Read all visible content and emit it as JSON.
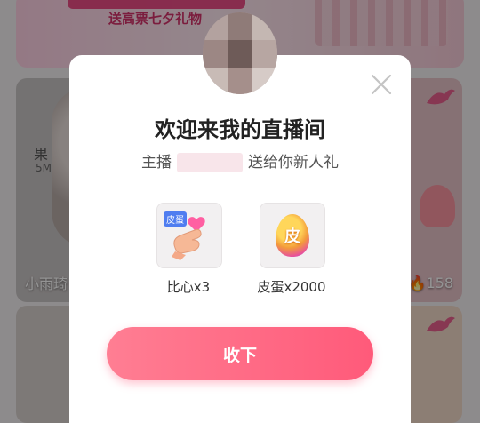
{
  "background": {
    "banner_text": "送高票七夕礼物",
    "card_left_name": "小雨琦",
    "card_left_side_text": "果",
    "card_left_side_small": "5M",
    "card_right_count": "158"
  },
  "modal": {
    "title": "欢迎来我的直播间",
    "subtitle_prefix": "主播",
    "subtitle_suffix": "送给你新人礼",
    "gifts": [
      {
        "icon": "finger-heart-icon",
        "tag": "皮蛋",
        "label": "比心x3"
      },
      {
        "icon": "egg-icon",
        "glyph": "皮",
        "label": "皮蛋x2000"
      }
    ],
    "accept_label": "收下",
    "close_icon": "close-icon"
  },
  "colors": {
    "accent": "#ff5a7a",
    "accent_light": "#ff7e93"
  }
}
